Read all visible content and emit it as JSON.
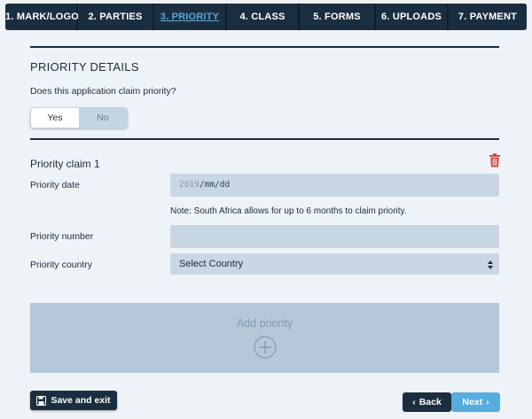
{
  "tabs": [
    {
      "label": "1. MARK/LOGO"
    },
    {
      "label": "2. PARTIES"
    },
    {
      "label": "3. PRIORITY"
    },
    {
      "label": "4. CLASS"
    },
    {
      "label": "5. FORMS"
    },
    {
      "label": "6. UPLOADS"
    },
    {
      "label": "7. PAYMENT"
    }
  ],
  "active_tab": "3. PRIORITY",
  "section": {
    "title": "PRIORITY DETAILS",
    "question": "Does this application claim priority?",
    "toggle": {
      "yes_label": "Yes",
      "no_label": "No",
      "selected": "Yes"
    }
  },
  "claim": {
    "title": "Priority claim 1",
    "date_label": "Priority date",
    "date_value_year": "2019",
    "date_value_rest": "/mm/dd",
    "note": "Note: South Africa allows for up to 6 months to claim priority.",
    "number_label": "Priority number",
    "number_value": "",
    "country_label": "Priority country",
    "country_value": "Select Country"
  },
  "add_priority": {
    "label": "Add priority"
  },
  "footer": {
    "save_label": "Save and exit",
    "back_label": "Back",
    "next_label": "Next"
  },
  "colors": {
    "navy": "#1b2e40",
    "accent": "#55acdf",
    "delete": "#d83a3a"
  }
}
